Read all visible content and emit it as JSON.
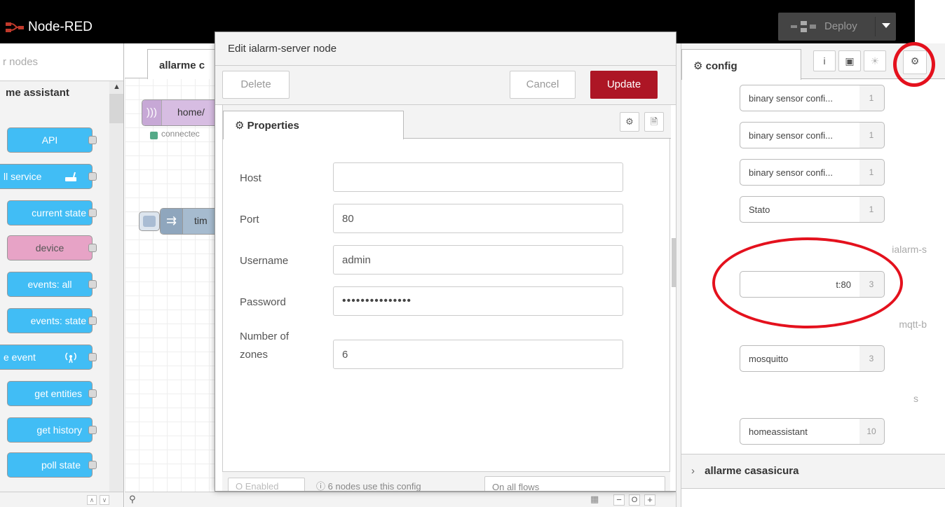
{
  "header": {
    "title": "Node-RED",
    "deploy_label": "Deploy"
  },
  "palette": {
    "filter_placeholder": "r nodes",
    "category": "me assistant",
    "nodes": [
      {
        "label": "API"
      },
      {
        "label": "ll service"
      },
      {
        "label": "current state"
      },
      {
        "label": "device"
      },
      {
        "label": "events: all"
      },
      {
        "label": "events: state"
      },
      {
        "label": "e event"
      },
      {
        "label": "get entities"
      },
      {
        "label": "get history"
      },
      {
        "label": "poll state"
      }
    ]
  },
  "workspace": {
    "tab_label": "allarme c",
    "node1_label": "home/",
    "node1_status": "connectec",
    "node2_label": "tim"
  },
  "dialog": {
    "title": "Edit ialarm-server node",
    "delete_label": "Delete",
    "cancel_label": "Cancel",
    "update_label": "Update",
    "properties_tab": "Properties",
    "fields": {
      "host": {
        "label": "Host",
        "value": ""
      },
      "port": {
        "label": "Port",
        "value": "80"
      },
      "username": {
        "label": "Username",
        "value": "admin"
      },
      "password": {
        "label": "Password",
        "value": "•••••••••••••••"
      },
      "zones": {
        "label_line1": "Number of",
        "label_line2": "zones",
        "value": "6"
      }
    },
    "footer": {
      "enabled_label": "O  Enabled",
      "info": "6 nodes use this config",
      "scope": "On all flows"
    }
  },
  "sidebar": {
    "tab_label": "config",
    "config_nodes": [
      {
        "label": "binary sensor confi...",
        "count": "1"
      },
      {
        "label": "binary sensor confi...",
        "count": "1"
      },
      {
        "label": "binary sensor confi...",
        "count": "1"
      },
      {
        "label": "Stato",
        "count": "1"
      },
      {
        "label": "t:80",
        "count": "3"
      },
      {
        "label": "mosquitto",
        "count": "3"
      },
      {
        "label": "homeassistant",
        "count": "10"
      }
    ],
    "groups": {
      "ialarm": "ialarm-s",
      "mqtt": "mqtt-b",
      "ha": "s"
    },
    "flow_section": "allarme casasicura"
  },
  "colors": {
    "accent": "#ad1625",
    "node_blue": "#41bdf5",
    "node_pink": "#e7a3c6",
    "annotation_red": "#e4111d"
  }
}
